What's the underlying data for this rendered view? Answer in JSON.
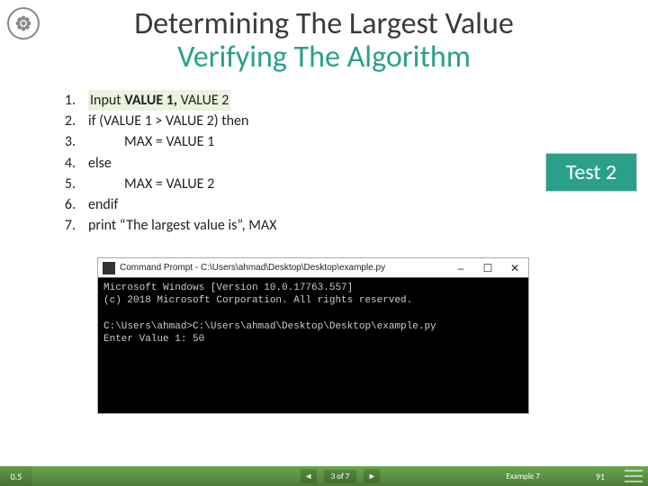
{
  "title": {
    "line1": "Determining The Largest Value",
    "line2": "Verifying The Algorithm"
  },
  "algorithm": {
    "lines": [
      {
        "n": "1.",
        "pre": "Input ",
        "bold": "VALUE 1,",
        "post": " VALUE 2",
        "highlight": true
      },
      {
        "n": "2.",
        "text": "if (VALUE 1 > VALUE 2) then"
      },
      {
        "n": "3.",
        "text": "MAX = VALUE 1",
        "indent": true
      },
      {
        "n": "4.",
        "text": "else"
      },
      {
        "n": "5.",
        "text": "MAX = VALUE 2",
        "indent": true
      },
      {
        "n": "6.",
        "text": "endif"
      },
      {
        "n": "7.",
        "text": "print “The largest value is”, MAX"
      }
    ]
  },
  "badge": {
    "label": "Test 2"
  },
  "terminal": {
    "title": "Command Prompt - C:\\Users\\ahmad\\Desktop\\Desktop\\example.py",
    "buttons": {
      "min": "–",
      "max": "☐",
      "close": "✕"
    },
    "body": "Microsoft Windows [Version 10.0.17763.557]\n(c) 2018 Microsoft Corporation. All rights reserved.\n\nC:\\Users\\ahmad>C:\\Users\\ahmad\\Desktop\\Desktop\\example.py\nEnter Value 1: 50"
  },
  "footer": {
    "left": "0.5",
    "prev": "◄",
    "next": "►",
    "indicator": "3 of 7",
    "example": "Example 7",
    "page": "91"
  }
}
